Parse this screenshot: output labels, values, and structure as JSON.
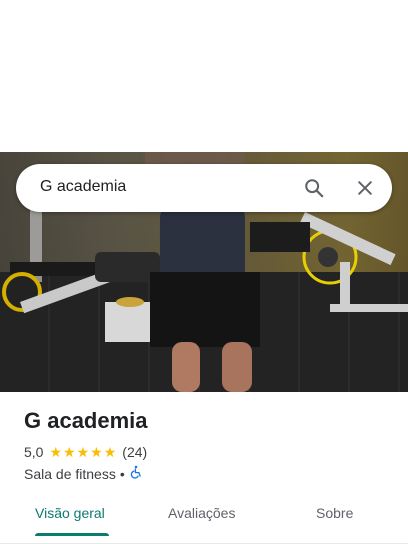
{
  "search": {
    "query": "G academia"
  },
  "place": {
    "name": "G academia",
    "rating": "5,0",
    "stars_filled": 5,
    "review_count": "(24)",
    "category": "Sala de fitness",
    "separator": "•"
  },
  "tabs": [
    {
      "label": "Visão geral",
      "active": true
    },
    {
      "label": "Avaliações",
      "active": false
    },
    {
      "label": "Sobre",
      "active": false
    }
  ],
  "colors": {
    "accent": "#0b7a70",
    "star": "#fbbc04",
    "accessible_icon": "#1a73e8"
  },
  "icons": {
    "search": "search-icon",
    "close": "close-icon",
    "accessibility": "wheelchair-icon",
    "star": "star-icon"
  }
}
